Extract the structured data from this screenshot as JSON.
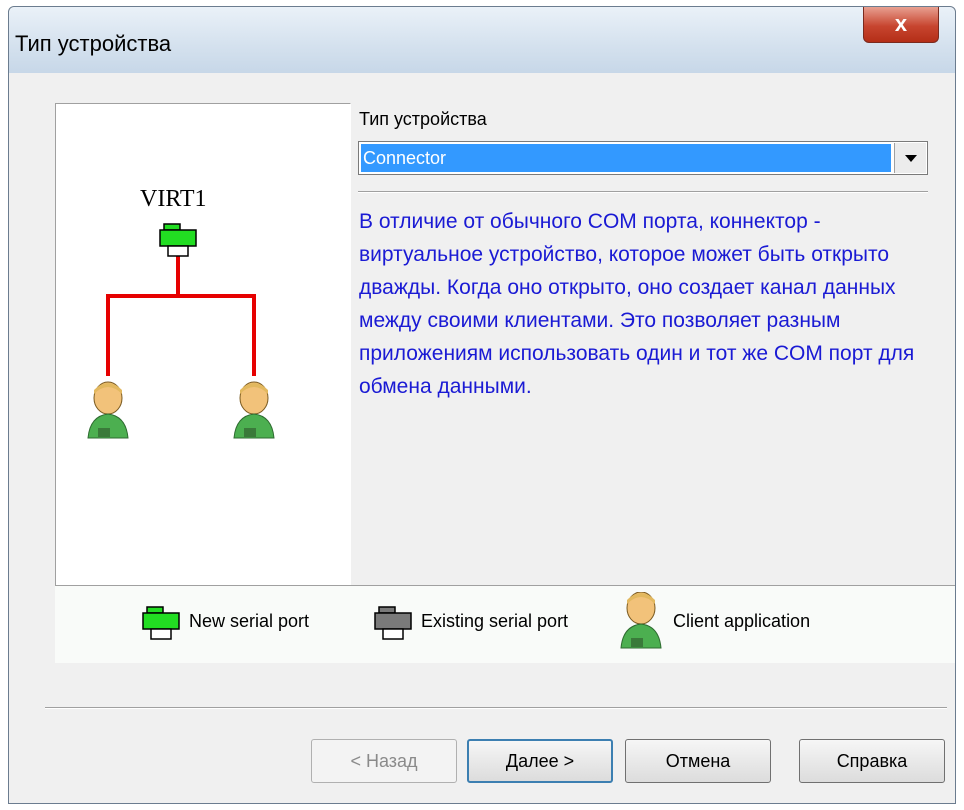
{
  "window": {
    "title": "Тип устройства",
    "close_label": "x"
  },
  "diagram": {
    "device_name": "VIRT1"
  },
  "device_type": {
    "label": "Тип устройства",
    "selected": "Connector",
    "description": "В отличие от обычного COM порта, коннектор - виртуальное устройство, которое может быть открыто дважды. Когда оно открыто, оно создает канал данных между своими клиентами. Это позволяет разным приложениям использовать один и тот же COM порт для обмена данными."
  },
  "legend": {
    "new_port": "New serial port",
    "existing_port": "Existing serial port",
    "client_app": "Client application"
  },
  "buttons": {
    "back": "< Назад",
    "next": "Далее >",
    "cancel": "Отмена",
    "help": "Справка"
  },
  "colors": {
    "accent": "#3399ff",
    "description_text": "#1a1ad4",
    "connector_line": "#e60000",
    "new_port": "#22dd22",
    "existing_port": "#7a7a7a"
  },
  "icons": [
    "close-icon",
    "serial-port-icon",
    "client-application-icon",
    "dropdown-arrow-icon"
  ]
}
